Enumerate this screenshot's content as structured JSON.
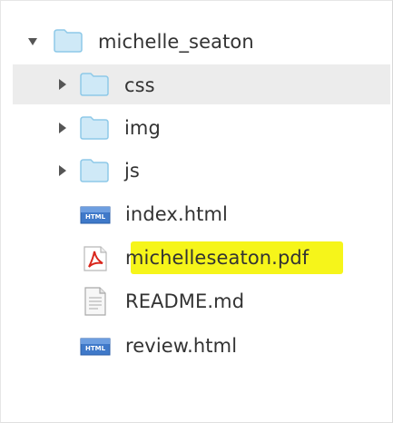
{
  "tree": {
    "root": {
      "label": "michelle_seaton",
      "icon": "folder-icon",
      "expanded": true
    },
    "folders": [
      {
        "label": "css",
        "icon": "folder-icon",
        "expanded": false
      },
      {
        "label": "img",
        "icon": "folder-icon",
        "expanded": false
      },
      {
        "label": "js",
        "icon": "folder-icon",
        "expanded": false
      }
    ],
    "files": [
      {
        "label": "index.html",
        "icon": "html-file-icon"
      },
      {
        "label": "michelleseaton.pdf",
        "icon": "pdf-file-icon",
        "highlighted": true
      },
      {
        "label": "README.md",
        "icon": "text-file-icon"
      },
      {
        "label": "review.html",
        "icon": "html-file-icon"
      }
    ],
    "html_badge": "HTML"
  },
  "colors": {
    "folder_fill": "#cfe9f7",
    "folder_stroke": "#8ec9e8",
    "selection": "#ececec",
    "highlight": "#f6f51a",
    "pdf_red": "#d9261c"
  }
}
